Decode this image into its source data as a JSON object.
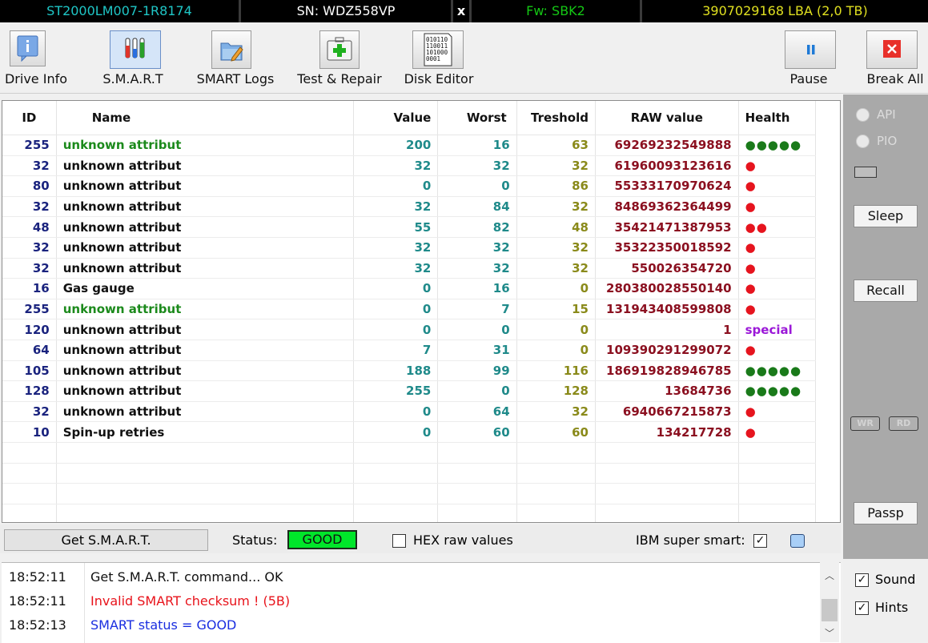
{
  "drive_bar": {
    "model": "ST2000LM007-1R8174",
    "serial": "SN: WDZ558VP",
    "close": "x",
    "firmware": "Fw: SBK2",
    "capacity": "3907029168 LBA (2,0 TB)"
  },
  "toolbar": {
    "drive_info": "Drive Info",
    "smart": "S.M.A.R.T",
    "smart_logs": "SMART Logs",
    "test_repair": "Test & Repair",
    "disk_editor": "Disk Editor",
    "pause": "Pause",
    "break_all": "Break All",
    "disk_editor_icon_text": [
      "010110",
      "110011",
      "101000",
      "0001"
    ]
  },
  "table": {
    "columns": [
      "ID",
      "Name",
      "Value",
      "Worst",
      "Treshold",
      "RAW value",
      "Health"
    ],
    "rows": [
      {
        "id": "255",
        "name": "unknown attribut",
        "value": "200",
        "worst": "16",
        "threshold": "63",
        "raw": "69269232549888",
        "health": "●●●●●",
        "health_type": "green",
        "name_color": "green"
      },
      {
        "id": "32",
        "name": "unknown attribut",
        "value": "32",
        "worst": "32",
        "threshold": "32",
        "raw": "61960093123616",
        "health": "●",
        "health_type": "red",
        "name_color": "black"
      },
      {
        "id": "80",
        "name": "unknown attribut",
        "value": "0",
        "worst": "0",
        "threshold": "86",
        "raw": "55333170970624",
        "health": "●",
        "health_type": "red",
        "name_color": "black"
      },
      {
        "id": "32",
        "name": "unknown attribut",
        "value": "32",
        "worst": "84",
        "threshold": "32",
        "raw": "84869362364499",
        "health": "●",
        "health_type": "red",
        "name_color": "black"
      },
      {
        "id": "48",
        "name": "unknown attribut",
        "value": "55",
        "worst": "82",
        "threshold": "48",
        "raw": "35421471387953",
        "health": "●●",
        "health_type": "red",
        "name_color": "black"
      },
      {
        "id": "32",
        "name": "unknown attribut",
        "value": "32",
        "worst": "32",
        "threshold": "32",
        "raw": "35322350018592",
        "health": "●",
        "health_type": "red",
        "name_color": "black"
      },
      {
        "id": "32",
        "name": "unknown attribut",
        "value": "32",
        "worst": "32",
        "threshold": "32",
        "raw": "550026354720",
        "health": "●",
        "health_type": "red",
        "name_color": "black"
      },
      {
        "id": "16",
        "name": "Gas gauge",
        "value": "0",
        "worst": "16",
        "threshold": "0",
        "raw": "280380028550140",
        "health": "●",
        "health_type": "red",
        "name_color": "black"
      },
      {
        "id": "255",
        "name": "unknown attribut",
        "value": "0",
        "worst": "7",
        "threshold": "15",
        "raw": "131943408599808",
        "health": "●",
        "health_type": "red",
        "name_color": "green"
      },
      {
        "id": "120",
        "name": "unknown attribut",
        "value": "0",
        "worst": "0",
        "threshold": "0",
        "raw": "1",
        "health": "special",
        "health_type": "special",
        "name_color": "black"
      },
      {
        "id": "64",
        "name": "unknown attribut",
        "value": "7",
        "worst": "31",
        "threshold": "0",
        "raw": "109390291299072",
        "health": "●",
        "health_type": "red",
        "name_color": "black"
      },
      {
        "id": "105",
        "name": "unknown attribut",
        "value": "188",
        "worst": "99",
        "threshold": "116",
        "raw": "186919828946785",
        "health": "●●●●●",
        "health_type": "green",
        "name_color": "black"
      },
      {
        "id": "128",
        "name": "unknown attribut",
        "value": "255",
        "worst": "0",
        "threshold": "128",
        "raw": "13684736",
        "health": "●●●●●",
        "health_type": "green",
        "name_color": "black"
      },
      {
        "id": "32",
        "name": "unknown attribut",
        "value": "0",
        "worst": "64",
        "threshold": "32",
        "raw": "6940667215873",
        "health": "●",
        "health_type": "red",
        "name_color": "black"
      },
      {
        "id": "10",
        "name": "Spin-up retries",
        "value": "0",
        "worst": "60",
        "threshold": "60",
        "raw": "134217728",
        "health": "●",
        "health_type": "red",
        "name_color": "black"
      }
    ]
  },
  "right_panel": {
    "api": "API",
    "pio": "PIO",
    "sleep": "Sleep",
    "recall": "Recall",
    "wr": "WR",
    "rd": "RD",
    "passp": "Passp"
  },
  "status_bar": {
    "get_smart": "Get S.M.A.R.T.",
    "status_label": "Status:",
    "status_value": "GOOD",
    "hex_raw": "HEX raw values",
    "hex_raw_checked": false,
    "ibm_super_smart": "IBM super smart:",
    "ibm_checked": true
  },
  "log": [
    {
      "time": "18:52:11",
      "message": "Get S.M.A.R.T. command... OK",
      "color": "#111111"
    },
    {
      "time": "18:52:11",
      "message": "Invalid SMART checksum ! (5B)",
      "color": "#e8131b"
    },
    {
      "time": "18:52:13",
      "message": "SMART status = GOOD",
      "color": "#1a2ee0"
    }
  ],
  "options": {
    "sound": "Sound",
    "sound_checked": true,
    "hints": "Hints",
    "hints_checked": true
  },
  "colors": {
    "model": "#1fc6c6",
    "serial": "#ffffff",
    "firmware": "#14c814",
    "capacity": "#e0e020",
    "status_good": "#00e62a"
  }
}
